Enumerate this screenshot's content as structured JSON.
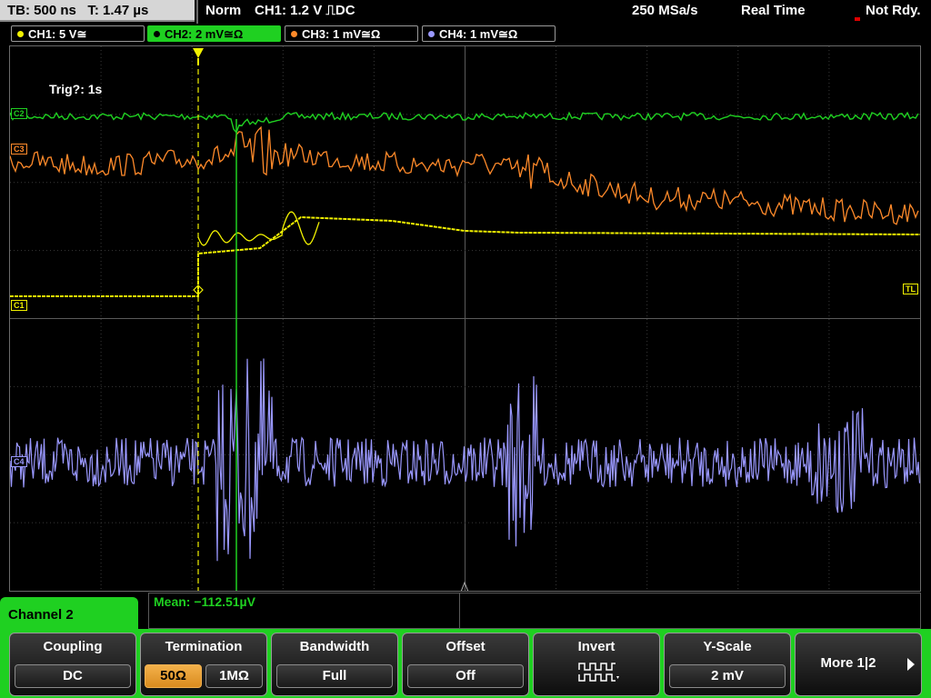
{
  "status_bar": {
    "timebase": "TB: 500 ns",
    "trigger_time": "T: 1.47 µs",
    "mode": "Norm",
    "trigger_setting": "CH1: 1.2 V ⎍DC",
    "sample_rate": "250 MSa/s",
    "acquisition": "Real Time",
    "trigger_status": "Not Rdy."
  },
  "channel_tabs": [
    {
      "label": "CH1: 5 V≅",
      "color": "#f2f200"
    },
    {
      "label": "CH2: 2 mV≅Ω",
      "color": "#1fd021"
    },
    {
      "label": "CH3: 1 mV≅Ω",
      "color": "#ff8a2a"
    },
    {
      "label": "CH4: 1 mV≅Ω",
      "color": "#9a98ff"
    }
  ],
  "plot": {
    "trigger_text": "Trig?: 1s",
    "markers": {
      "c1": "C1",
      "c2": "C2",
      "c3": "C3",
      "c4": "C4",
      "tl": "TL"
    },
    "colors": {
      "ch1": "#f2f200",
      "ch2": "#1fd021",
      "ch3": "#ff8a2a",
      "ch4": "#9a98ff"
    }
  },
  "panel": {
    "title": "Channel 2",
    "measurement": "Mean: −112.51µV"
  },
  "softkeys": {
    "coupling": {
      "title": "Coupling",
      "value": "DC"
    },
    "termination": {
      "title": "Termination",
      "options": [
        "50Ω",
        "1MΩ"
      ],
      "selected": "50Ω"
    },
    "bandwidth": {
      "title": "Bandwidth",
      "value": "Full"
    },
    "offset": {
      "title": "Offset",
      "value": "Off"
    },
    "invert": {
      "title": "Invert",
      "icon": "invert-waveform-icon"
    },
    "yscale": {
      "title": "Y-Scale",
      "value": "2 mV"
    },
    "more": {
      "label": "More 1|2"
    }
  }
}
